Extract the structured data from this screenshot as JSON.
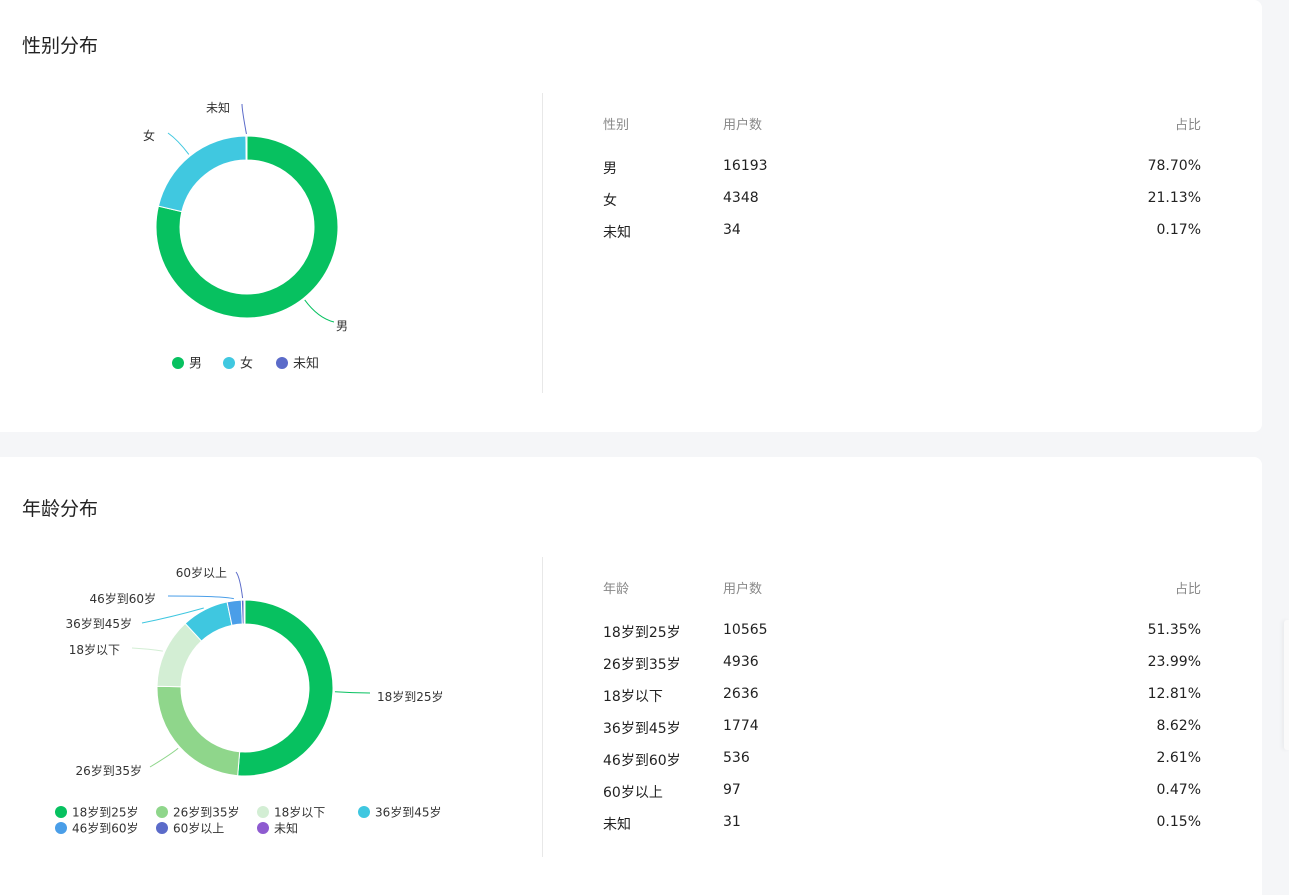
{
  "gender": {
    "title": "性别分布",
    "table": {
      "headers": [
        "性别",
        "用户数",
        "占比"
      ],
      "rows": [
        [
          "男",
          "16193",
          "78.70%"
        ],
        [
          "女",
          "4348",
          "21.13%"
        ],
        [
          "未知",
          "34",
          "0.17%"
        ]
      ]
    }
  },
  "age": {
    "title": "年龄分布",
    "table": {
      "headers": [
        "年龄",
        "用户数",
        "占比"
      ],
      "rows": [
        [
          "18岁到25岁",
          "10565",
          "51.35%"
        ],
        [
          "26岁到35岁",
          "4936",
          "23.99%"
        ],
        [
          "18岁以下",
          "2636",
          "12.81%"
        ],
        [
          "36岁到45岁",
          "1774",
          "8.62%"
        ],
        [
          "46岁到60岁",
          "536",
          "2.61%"
        ],
        [
          "60岁以上",
          "97",
          "0.47%"
        ],
        [
          "未知",
          "31",
          "0.15%"
        ]
      ]
    }
  },
  "chart_data": [
    {
      "type": "pie",
      "variant": "donut",
      "title": "性别分布",
      "categories": [
        "男",
        "女",
        "未知"
      ],
      "values": [
        16193,
        4348,
        34
      ],
      "colors": [
        "#07c160",
        "#40c8e0",
        "#5b6bc9"
      ],
      "legend": "bottom",
      "slice_labels": true
    },
    {
      "type": "pie",
      "variant": "donut",
      "title": "年龄分布",
      "categories": [
        "18岁到25岁",
        "26岁到35岁",
        "18岁以下",
        "36岁到45岁",
        "46岁到60岁",
        "60岁以上",
        "未知"
      ],
      "values": [
        10565,
        4936,
        2636,
        1774,
        536,
        97,
        31
      ],
      "colors": [
        "#07c160",
        "#8fd68b",
        "#d3eed4",
        "#3fc7e0",
        "#4a9ee8",
        "#5b6bc9",
        "#8e5bd0"
      ],
      "legend": "bottom",
      "slice_labels": true
    }
  ]
}
